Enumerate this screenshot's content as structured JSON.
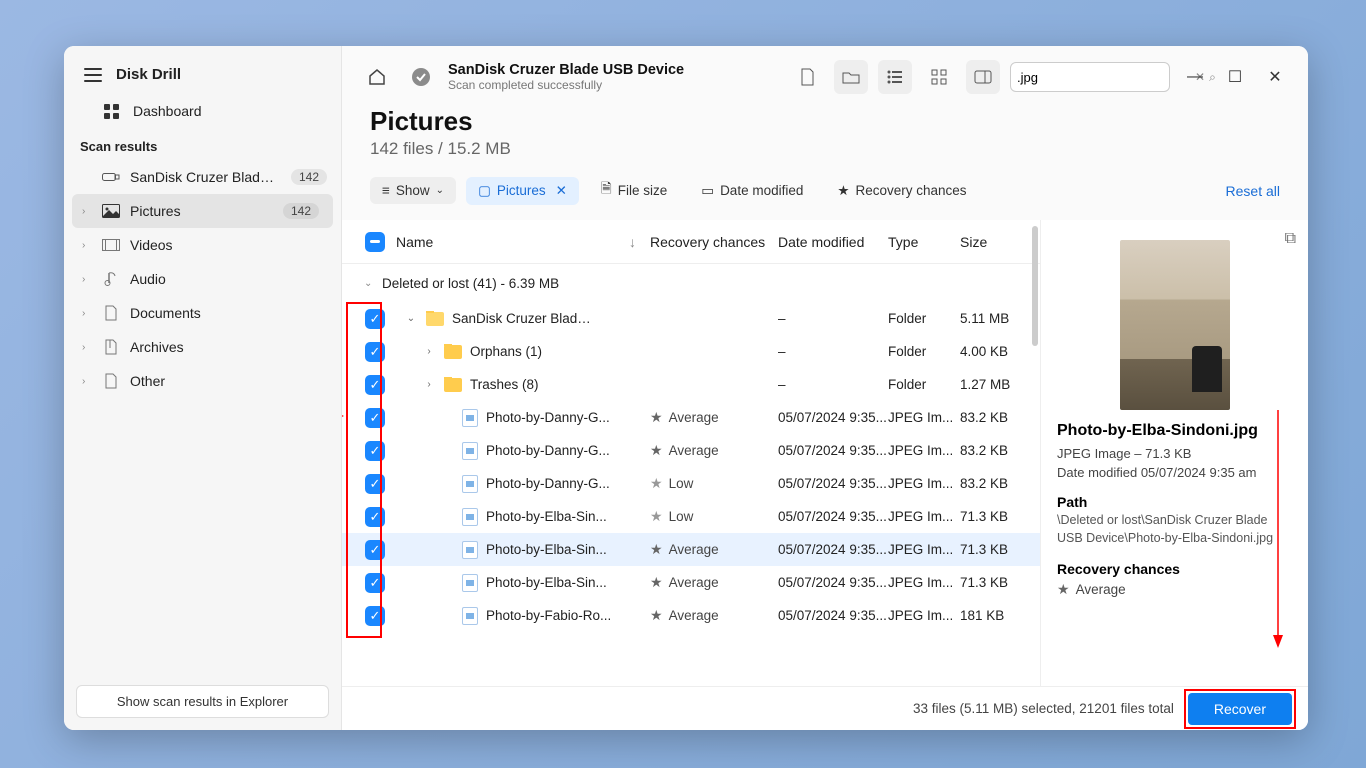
{
  "app": {
    "title": "Disk Drill",
    "dashboard": "Dashboard",
    "section": "Scan results",
    "explorer_btn": "Show scan results in Explorer"
  },
  "sidebar": {
    "items": [
      {
        "label": "SanDisk Cruzer Blade US...",
        "badge": "142"
      },
      {
        "label": "Pictures",
        "badge": "142"
      },
      {
        "label": "Videos"
      },
      {
        "label": "Audio"
      },
      {
        "label": "Documents"
      },
      {
        "label": "Archives"
      },
      {
        "label": "Other"
      }
    ]
  },
  "header": {
    "device": "SanDisk Cruzer Blade USB Device",
    "status": "Scan completed successfully",
    "search_value": ".jpg"
  },
  "page": {
    "title": "Pictures",
    "subtitle": "142 files / 15.2 MB"
  },
  "filters": {
    "show": "Show",
    "pictures": "Pictures",
    "filesize": "File size",
    "datemod": "Date modified",
    "recchance": "Recovery chances",
    "reset": "Reset all"
  },
  "cols": {
    "name": "Name",
    "rec": "Recovery chances",
    "date": "Date modified",
    "type": "Type",
    "size": "Size"
  },
  "group": "Deleted or lost (41) - 6.39 MB",
  "rows": [
    {
      "indent": 0,
      "exp": "⌄",
      "icon": "folder-open",
      "name": "SanDisk Cruzer Blade...",
      "rec": "",
      "date": "–",
      "type": "Folder",
      "size": "5.11 MB"
    },
    {
      "indent": 1,
      "exp": "›",
      "icon": "folder",
      "name": "Orphans (1)",
      "rec": "",
      "date": "–",
      "type": "Folder",
      "size": "4.00 KB"
    },
    {
      "indent": 1,
      "exp": "›",
      "icon": "folder",
      "name": "Trashes (8)",
      "rec": "",
      "date": "–",
      "type": "Folder",
      "size": "1.27 MB"
    },
    {
      "indent": 2,
      "exp": "",
      "icon": "file",
      "name": "Photo-by-Danny-G...",
      "rec": "Average",
      "star": "filled",
      "date": "05/07/2024 9:35...",
      "type": "JPEG Im...",
      "size": "83.2 KB"
    },
    {
      "indent": 2,
      "exp": "",
      "icon": "file",
      "name": "Photo-by-Danny-G...",
      "rec": "Average",
      "star": "filled",
      "date": "05/07/2024 9:35...",
      "type": "JPEG Im...",
      "size": "83.2 KB"
    },
    {
      "indent": 2,
      "exp": "",
      "icon": "file",
      "name": "Photo-by-Danny-G...",
      "rec": "Low",
      "star": "",
      "date": "05/07/2024 9:35...",
      "type": "JPEG Im...",
      "size": "83.2 KB"
    },
    {
      "indent": 2,
      "exp": "",
      "icon": "file",
      "name": "Photo-by-Elba-Sin...",
      "rec": "Low",
      "star": "",
      "date": "05/07/2024 9:35...",
      "type": "JPEG Im...",
      "size": "71.3 KB"
    },
    {
      "indent": 2,
      "exp": "",
      "icon": "file",
      "name": "Photo-by-Elba-Sin...",
      "rec": "Average",
      "star": "filled",
      "date": "05/07/2024 9:35...",
      "type": "JPEG Im...",
      "size": "71.3 KB",
      "sel": true
    },
    {
      "indent": 2,
      "exp": "",
      "icon": "file",
      "name": "Photo-by-Elba-Sin...",
      "rec": "Average",
      "star": "filled",
      "date": "05/07/2024 9:35...",
      "type": "JPEG Im...",
      "size": "71.3 KB"
    },
    {
      "indent": 2,
      "exp": "",
      "icon": "file",
      "name": "Photo-by-Fabio-Ro...",
      "rec": "Average",
      "star": "filled",
      "date": "05/07/2024 9:35...",
      "type": "JPEG Im...",
      "size": "181 KB"
    }
  ],
  "details": {
    "filename": "Photo-by-Elba-Sindoni.jpg",
    "meta1": "JPEG Image – 71.3 KB",
    "meta2": "Date modified 05/07/2024 9:35 am",
    "path_label": "Path",
    "path": "\\Deleted or lost\\SanDisk Cruzer Blade USB Device\\Photo-by-Elba-Sindoni.jpg",
    "rc_label": "Recovery chances",
    "rc_value": "Average"
  },
  "footer": {
    "status": "33 files (5.11 MB) selected, 21201 files total",
    "recover": "Recover"
  }
}
